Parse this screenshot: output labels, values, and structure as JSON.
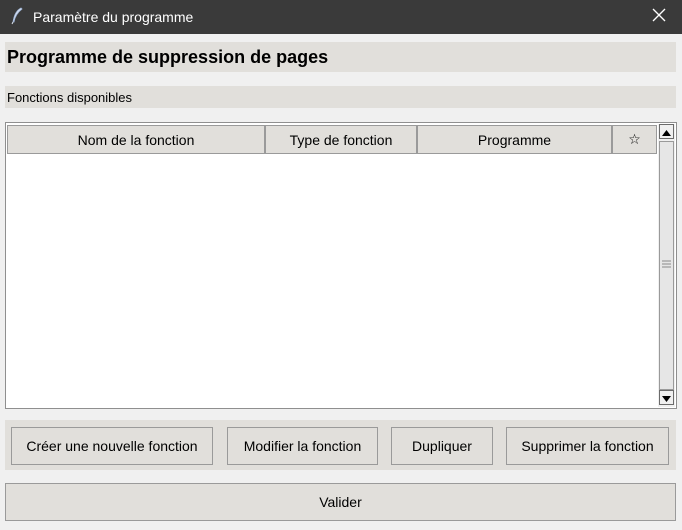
{
  "window": {
    "title": "Paramètre du programme",
    "app_icon": "feather-quill-icon",
    "close_icon": "close-icon"
  },
  "header": {
    "title": "Programme de suppression de pages"
  },
  "section": {
    "label": "Fonctions disponibles"
  },
  "table": {
    "columns": [
      "Nom de la fonction",
      "Type de fonction",
      "Programme",
      "☆"
    ],
    "rows": []
  },
  "actions": {
    "create_label": "Créer une nouvelle fonction",
    "modify_label": "Modifier la fonction",
    "duplicate_label": "Dupliquer",
    "delete_label": "Supprimer la fonction"
  },
  "footer": {
    "validate_label": "Valider"
  },
  "colors": {
    "titlebar": "#3a3a3a",
    "panel": "#e1dfdb",
    "background": "#f0f0f0"
  }
}
